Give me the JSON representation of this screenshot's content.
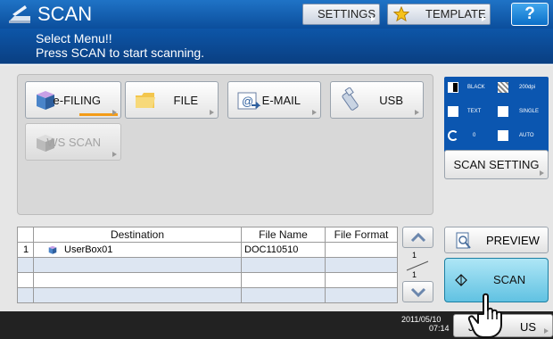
{
  "title": "SCAN",
  "header": {
    "settings_label": "SETTINGS",
    "template_label": "TEMPLATE",
    "help_label": "?"
  },
  "message": {
    "line1": "Select Menu!!",
    "line2": "Press SCAN to start scanning."
  },
  "menu": {
    "efiling": "e-FILING",
    "file": "FILE",
    "email": "E-MAIL",
    "usb": "USB",
    "wsscan": "WS SCAN"
  },
  "settings_info": {
    "color": "BLACK",
    "resolution": "200dpi",
    "mode": "TEXT",
    "sides": "SINGLE",
    "rotation": "0",
    "size": "AUTO"
  },
  "scan_setting_label": "SCAN SETTING",
  "table": {
    "headers": {
      "destination": "Destination",
      "file_name": "File Name",
      "file_format": "File Format"
    },
    "rows": [
      {
        "num": "1",
        "destination": "UserBox01",
        "file_name": "DOC110510",
        "file_format": ""
      }
    ]
  },
  "pagination": {
    "current": "1",
    "total": "1"
  },
  "preview_label": "PREVIEW",
  "scan_label": "SCAN",
  "footer": {
    "date": "2011/05/10",
    "time": "07:14",
    "job_status_left": "JO",
    "job_status_right": "US"
  },
  "colors": {
    "title_blue": "#0b4e9c",
    "scan_button": "#61c2e2",
    "info_panel": "#0b56b0",
    "accent_orange": "#f39c18"
  }
}
